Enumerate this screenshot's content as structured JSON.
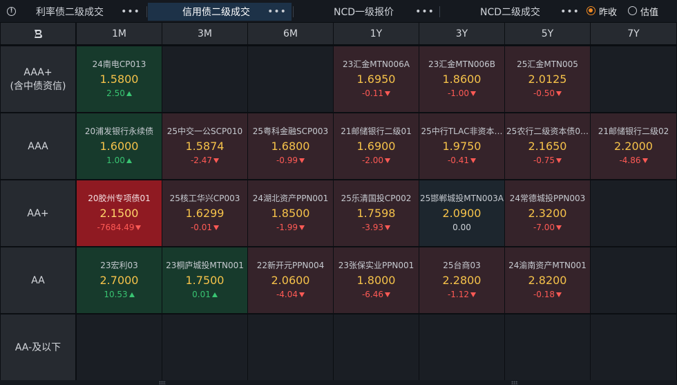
{
  "tabs": [
    {
      "label": "利率债二级成交",
      "active": false
    },
    {
      "label": "信用债二级成交",
      "active": true
    },
    {
      "label": "NCD一级报价",
      "active": false
    },
    {
      "label": "NCD二级成交",
      "active": false
    }
  ],
  "radios": [
    {
      "label": "昨收",
      "checked": true
    },
    {
      "label": "估值",
      "checked": false
    }
  ],
  "colors": {
    "accent": "#f08a24",
    "up": "#39c472",
    "down": "#ff5a55",
    "yield": "#f5c24a"
  },
  "corner_icon": "brand-logo-icon",
  "columns": [
    "1M",
    "3M",
    "6M",
    "1Y",
    "3Y",
    "5Y",
    "7Y"
  ],
  "rows": [
    {
      "label": [
        "AAA+",
        "(含中债资信)"
      ],
      "cells": [
        {
          "name": "24南电CP013",
          "yield": "1.5800",
          "change": "2.50",
          "dir": "up"
        },
        null,
        null,
        {
          "name": "23汇金MTN006A",
          "yield": "1.6950",
          "change": "-0.11",
          "dir": "down"
        },
        {
          "name": "23汇金MTN006B",
          "yield": "1.8600",
          "change": "-1.00",
          "dir": "down"
        },
        {
          "name": "25汇金MTN005",
          "yield": "2.0125",
          "change": "-0.50",
          "dir": "down"
        },
        null
      ]
    },
    {
      "label": [
        "AAA"
      ],
      "cells": [
        {
          "name": "20浦发银行永续债",
          "yield": "1.6000",
          "change": "1.00",
          "dir": "up"
        },
        {
          "name": "25中交一公SCP010",
          "yield": "1.5874",
          "change": "-2.47",
          "dir": "down"
        },
        {
          "name": "25粤科金融SCP003",
          "yield": "1.6800",
          "change": "-0.99",
          "dir": "down"
        },
        {
          "name": "21邮储银行二级01",
          "yield": "1.6900",
          "change": "-2.00",
          "dir": "down"
        },
        {
          "name": "25中行TLAC非资本…",
          "yield": "1.9750",
          "change": "-0.41",
          "dir": "down"
        },
        {
          "name": "25农行二级资本债0…",
          "yield": "2.1650",
          "change": "-0.75",
          "dir": "down"
        },
        {
          "name": "21邮储银行二级02",
          "yield": "2.2000",
          "change": "-4.86",
          "dir": "down"
        }
      ]
    },
    {
      "label": [
        "AA+"
      ],
      "cells": [
        {
          "name": "20胶州专项债01",
          "yield": "2.1500",
          "change": "-7684.49",
          "dir": "hot"
        },
        {
          "name": "25核工华兴CP003",
          "yield": "1.6299",
          "change": "-0.01",
          "dir": "down"
        },
        {
          "name": "24湖北资产PPN001",
          "yield": "1.8500",
          "change": "-1.99",
          "dir": "down"
        },
        {
          "name": "25乐清国投CP002",
          "yield": "1.7598",
          "change": "-3.93",
          "dir": "down"
        },
        {
          "name": "25邯郸城投MTN003A",
          "yield": "2.0900",
          "change": "0.00",
          "dir": "flat"
        },
        {
          "name": "24常德城投PPN003",
          "yield": "2.3200",
          "change": "-7.00",
          "dir": "down"
        },
        null
      ]
    },
    {
      "label": [
        "AA"
      ],
      "cells": [
        {
          "name": "23宏利03",
          "yield": "2.7000",
          "change": "10.53",
          "dir": "up"
        },
        {
          "name": "23桐庐城投MTN001",
          "yield": "1.7500",
          "change": "0.01",
          "dir": "up"
        },
        {
          "name": "22新开元PPN004",
          "yield": "2.0600",
          "change": "-4.04",
          "dir": "down"
        },
        {
          "name": "23张保实业PPN001",
          "yield": "1.8000",
          "change": "-6.46",
          "dir": "down"
        },
        {
          "name": "25台商03",
          "yield": "2.2800",
          "change": "-1.12",
          "dir": "down"
        },
        {
          "name": "24渝南资产MTN001",
          "yield": "2.8200",
          "change": "-0.18",
          "dir": "down"
        },
        null
      ]
    },
    {
      "label": [
        "AA-及以下"
      ],
      "cells": [
        null,
        null,
        null,
        null,
        null,
        null,
        null
      ]
    }
  ]
}
